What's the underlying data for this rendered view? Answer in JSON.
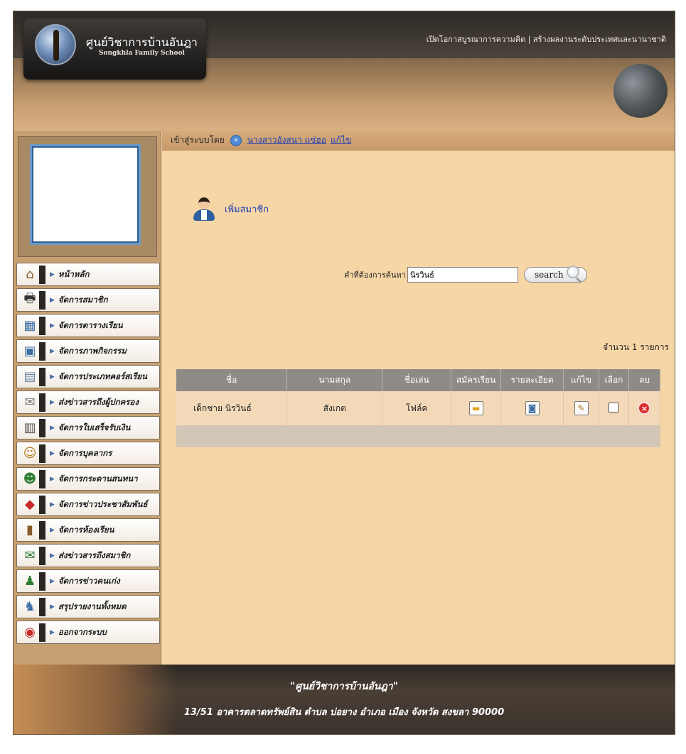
{
  "header": {
    "school_name": "ศูนย์วิชาการบ้านอันฎา",
    "school_sub": "Songkhla Family School",
    "slogan": "เปิดโอกาสบูรณาการความคิด  |  สร้างผลงานระดับประเทศและนานาชาติ"
  },
  "sidebar": {
    "items": [
      {
        "label": "หน้าหลัก",
        "icon": "home-icon"
      },
      {
        "label": "จัดการสมาชิก",
        "icon": "printer-icon"
      },
      {
        "label": "จัดการตารางเรียน",
        "icon": "calendar-icon"
      },
      {
        "label": "จัดการภาพกิจกรรม",
        "icon": "photo-icon"
      },
      {
        "label": "จัดการประเภทคอร์สเรียน",
        "icon": "folder-icon"
      },
      {
        "label": "ส่งข่าวสารถึงผู้ปกครอง",
        "icon": "envelope-icon"
      },
      {
        "label": "จัดการใบเสร็จรับเงิน",
        "icon": "receipt-icon"
      },
      {
        "label": "จัดการบุคลากร",
        "icon": "people-icon"
      },
      {
        "label": "จัดการกระดานสนทนา",
        "icon": "chat-icon"
      },
      {
        "label": "จัดการข่าวประชาสัมพันธ์",
        "icon": "megaphone-icon"
      },
      {
        "label": "จัดการห้องเรียน",
        "icon": "classroom-icon"
      },
      {
        "label": "ส่งข่าวสารถึงสมาชิก",
        "icon": "member-mail-icon"
      },
      {
        "label": "จัดการข่าวคนเก่ง",
        "icon": "star-person-icon"
      },
      {
        "label": "สรุปรายงานทั้งหมด",
        "icon": "report-icon"
      },
      {
        "label": "ออกจากระบบ",
        "icon": "logout-icon"
      }
    ]
  },
  "login": {
    "label": "เข้าสู่ระบบโดย",
    "user": "นางสาวอังสนา แซ่ฮอ",
    "edit": "แก้ไข"
  },
  "add_member": {
    "label": "เพิ่มสมาชิก"
  },
  "search": {
    "label": "คำที่ต้องการค้นหา",
    "value": "นิรวินธ์",
    "button": "search"
  },
  "count_text": "จำนวน 1 รายการ",
  "table": {
    "headers": [
      "ชื่อ",
      "นามสกุล",
      "ชื่อเล่น",
      "สมัครเรียน",
      "รายละเอียด",
      "แก้ไข",
      "เลือก",
      "ลบ"
    ],
    "rows": [
      {
        "name": "เด็กชาย  นิรวินธ์",
        "surname": "สังเกต",
        "nickname": "โฟล์ค",
        "selected": false
      }
    ]
  },
  "footer": {
    "title": "\"ศูนย์วิชาการบ้านอันฎา\"",
    "address": "13/51 อาคารตลาดทรัพย์สิน ตำบล บ่อยาง อำเภอ เมือง จังหวัด สงขลา 90000"
  }
}
